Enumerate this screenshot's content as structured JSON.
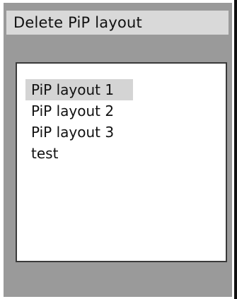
{
  "dialog": {
    "title": "Delete PiP layout"
  },
  "list": {
    "items": [
      {
        "label": "PiP layout 1",
        "selected": true
      },
      {
        "label": "PiP layout 2",
        "selected": false
      },
      {
        "label": "PiP layout 3",
        "selected": false
      },
      {
        "label": "test",
        "selected": false
      }
    ]
  }
}
